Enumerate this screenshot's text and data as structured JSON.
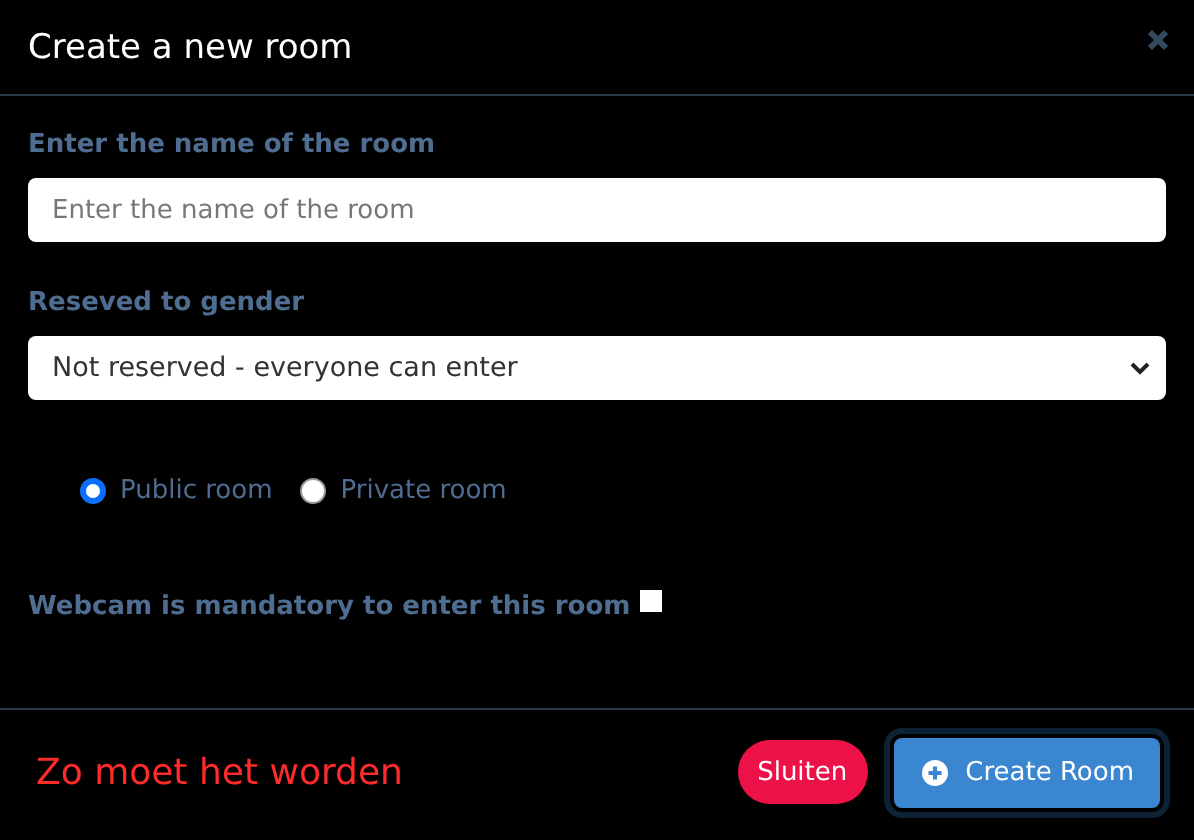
{
  "dialog": {
    "title": "Create a new room"
  },
  "name_field": {
    "label": "Enter the name of the room",
    "placeholder": "Enter the name of the room"
  },
  "gender_select": {
    "label": "Reseved to gender",
    "value": "Not reserved - everyone can enter"
  },
  "visibility": [
    {
      "label": "Public room",
      "selected": true
    },
    {
      "label": "Private room",
      "selected": false
    }
  ],
  "webcam": {
    "label": "Webcam is mandatory to enter this room",
    "checked": false
  },
  "footer": {
    "note": "Zo moet het worden",
    "buttons": [
      {
        "kind": "close",
        "label": "Sluiten"
      },
      {
        "kind": "create",
        "label": "Create Room"
      }
    ]
  }
}
